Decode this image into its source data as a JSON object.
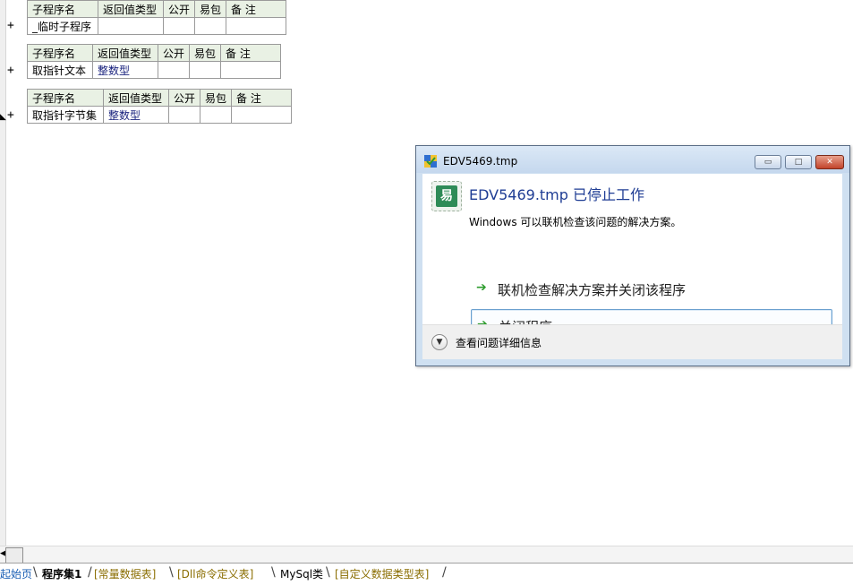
{
  "tables": [
    {
      "headers": [
        "子程序名",
        "返回值类型",
        "公开",
        "易包",
        "备 注"
      ],
      "row": [
        "_临时子程序",
        "",
        "",
        "",
        ""
      ]
    },
    {
      "headers": [
        "子程序名",
        "返回值类型",
        "公开",
        "易包",
        "备 注"
      ],
      "row": [
        "取指针文本",
        "整数型",
        "",
        "",
        ""
      ]
    },
    {
      "headers": [
        "子程序名",
        "返回值类型",
        "公开",
        "易包",
        "备 注"
      ],
      "row": [
        "取指针字节集",
        "整数型",
        "",
        "",
        ""
      ]
    }
  ],
  "expand_symbol": "+",
  "dialog": {
    "title": "EDV5469.tmp",
    "heading": "EDV5469.tmp 已停止工作",
    "description": "Windows 可以联机检查该问题的解决方案。",
    "options": [
      "联机检查解决方案并关闭该程序",
      "关闭程序"
    ],
    "details_label": "查看问题详细信息",
    "min_glyph": "▭",
    "max_glyph": "□",
    "close_glyph": "✕"
  },
  "tabs": [
    "起始页",
    "程序集1",
    "[常量数据表]",
    "[Dll命令定义表]",
    "MySql类",
    "[自定义数据类型表]"
  ],
  "colors": {
    "header_bg": "#e9f1e4",
    "link_blue": "#1f3d94",
    "arrow_green": "#2f9d2f"
  }
}
